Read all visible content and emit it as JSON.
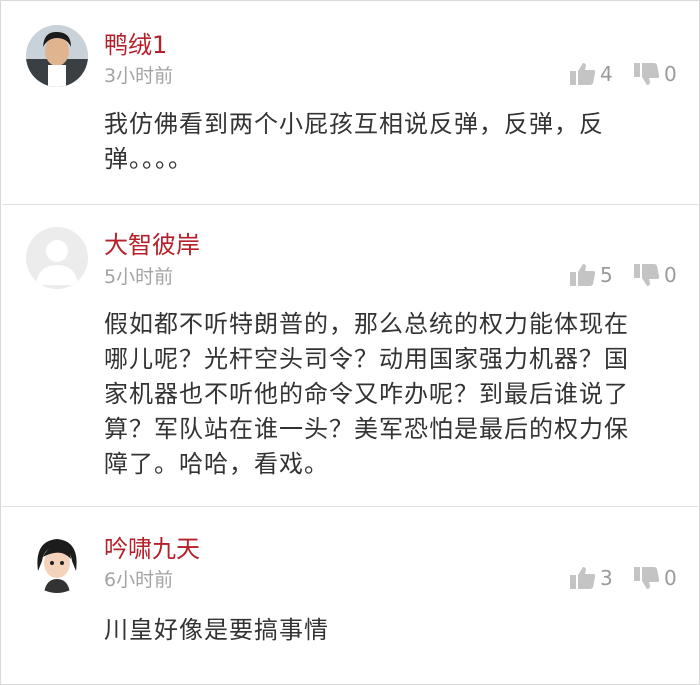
{
  "colors": {
    "username": "#b5202a",
    "timestamp": "#a3a3a3",
    "text": "#333333",
    "icon": "#c4c4c4",
    "divider": "#e1e1e1"
  },
  "comments": [
    {
      "username": "鸭绒1",
      "time": "3小时前",
      "likes": "4",
      "dislikes": "0",
      "lines": [
        "我仿佛看到两个小屁孩互相说反弹，反弹，反",
        "弹。。。。"
      ],
      "avatar_icon": "user-photo-avatar-icon"
    },
    {
      "username": "大智彼岸",
      "time": "5小时前",
      "likes": "5",
      "dislikes": "0",
      "lines": [
        "假如都不听特朗普的，那么总统的权力能体现在",
        "哪儿呢？光杆空头司令？动用国家强力机器？国",
        "家机器也不听他的命令又咋办呢？到最后谁说了",
        "算？军队站在谁一头？美军恐怕是最后的权力保",
        "障了。哈哈，看戏。"
      ],
      "avatar_icon": "default-avatar-icon"
    },
    {
      "username": "吟啸九天",
      "time": "6小时前",
      "likes": "3",
      "dislikes": "0",
      "lines": [
        "川皇好像是要搞事情"
      ],
      "avatar_icon": "cartoon-avatar-icon"
    }
  ]
}
